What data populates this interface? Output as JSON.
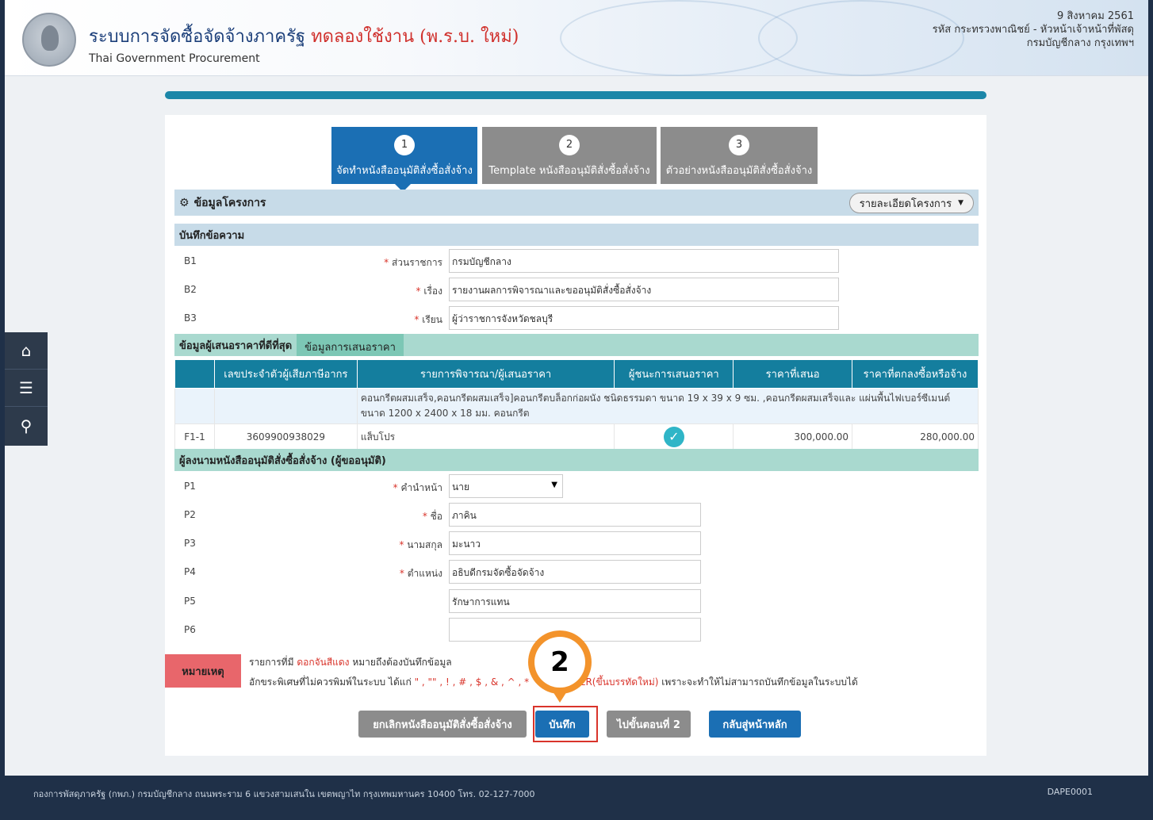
{
  "header": {
    "title": "ระบบการจัดซื้อจัดจ้างภาครัฐ",
    "trial": "ทดลองใช้งาน (พ.ร.บ. ใหม่)",
    "subtitle": "Thai Government Procurement",
    "date": "9 สิงหาคม 2561",
    "user_line1": "รหัส กระทรวงพาณิชย์ - หัวหน้าเจ้าหน้าที่พัสดุ",
    "user_line2": "กรมบัญชีกลาง กรุงเทพฯ"
  },
  "sidenav": {
    "home_icon": "home-icon",
    "menu_icon": "menu-icon",
    "search_icon": "search-icon"
  },
  "steps": [
    {
      "num": "1",
      "label": "จัดทำหนังสืออนุมัติสั่งซื้อสั่งจ้าง"
    },
    {
      "num": "2",
      "label": "Template หนังสืออนุมัติสั่งซื้อสั่งจ้าง"
    },
    {
      "num": "3",
      "label": "ตัวอย่างหนังสืออนุมัติสั่งซื้อสั่งจ้าง"
    }
  ],
  "project": {
    "title": "ข้อมูลโครงการ",
    "detail_button": "รายละเอียดโครงการ"
  },
  "memo": {
    "title": "บันทึกข้อความ",
    "rows": [
      {
        "code": "B1",
        "label": "ส่วนราชการ",
        "value": "กรมบัญชีกลาง"
      },
      {
        "code": "B2",
        "label": "เรื่อง",
        "value": "รายงานผลการพิจารณาและขออนุมัติสั่งซื้อสั่งจ้าง"
      },
      {
        "code": "B3",
        "label": "เรียน",
        "value": "ผู้ว่าราชการจังหวัดชลบุรี"
      }
    ]
  },
  "bidders": {
    "title": "ข้อมูลผู้เสนอราคาที่ดีที่สุด",
    "tab": "ข้อมูลการเสนอราคา",
    "headers": [
      "เลขประจำตัวผู้เสียภาษีอากร",
      "รายการพิจารณา/ผู้เสนอราคา",
      "ผู้ชนะการเสนอราคา",
      "ราคาที่เสนอ",
      "ราคาที่ตกลงซื้อหรือจ้าง"
    ],
    "item_desc": "คอนกรีตผสมเสร็จ,คอนกรีตผสมเสร็จ]คอนกรีตบล็อกก่อผนัง ชนิดธรรมดา ขนาด 19 x 39 x 9 ซม. ,คอนกรีตผสมเสร็จและ แผ่นพื้นไฟเบอร์ซีเมนต์ ขนาด 1200 x 2400 x 18 มม. คอนกรีต",
    "row": {
      "code": "F1-1",
      "tax_id": "3609900938029",
      "name": "แส็บโปร",
      "offer": "300,000.00",
      "agreed": "280,000.00"
    }
  },
  "signer": {
    "title": "ผู้ลงนามหนังสืออนุมัติสั่งซื้อสั่งจ้าง (ผู้ขออนุมัติ)",
    "rows": [
      {
        "code": "P1",
        "label": "คำนำหน้า",
        "value": "นาย"
      },
      {
        "code": "P2",
        "label": "ชื่อ",
        "value": "ภาคิน"
      },
      {
        "code": "P3",
        "label": "นามสกุล",
        "value": "มะนาว"
      },
      {
        "code": "P4",
        "label": "ตำแหน่ง",
        "value": "อธิบดีกรมจัดซื้อจัดจ้าง"
      },
      {
        "code": "P5",
        "label": "",
        "value": "รักษาการแทน"
      },
      {
        "code": "P6",
        "label": "",
        "value": ""
      }
    ]
  },
  "note": {
    "tag": "หมายเหตุ",
    "line1_a": "รายการที่มี",
    "line1_b": "ดอกจันสีแดง",
    "line1_c": "หมายถึงต้องบันทึกข้อมูล",
    "line2_a": "อักขระพิเศษที่ไม่ควรพิมพ์ในระบบ ได้แก่",
    "line2_b": "\" , \"\" , ! , # , $ , & , ^ , *",
    "line2_c": "ENTER(ขึ้นบรรทัดใหม่)",
    "line2_d": "เพราะจะทำให้ไม่สามารถบันทึกข้อมูลในระบบได้"
  },
  "buttons": {
    "cancel": "ยกเลิกหนังสืออนุมัติสั่งซื้อสั่งจ้าง",
    "save": "บันทึก",
    "next": "ไปขั้นตอนที่ 2",
    "back": "กลับสู่หน้าหลัก"
  },
  "callout": "2",
  "footer": {
    "address": "กองการพัสดุภาครัฐ (กพภ.) กรมบัญชีกลาง ถนนพระราม 6 แขวงสามเสนใน เขตพญาไท กรุงเทพมหานคร 10400 โทร. 02-127-7000",
    "code": "DAPE0001"
  }
}
